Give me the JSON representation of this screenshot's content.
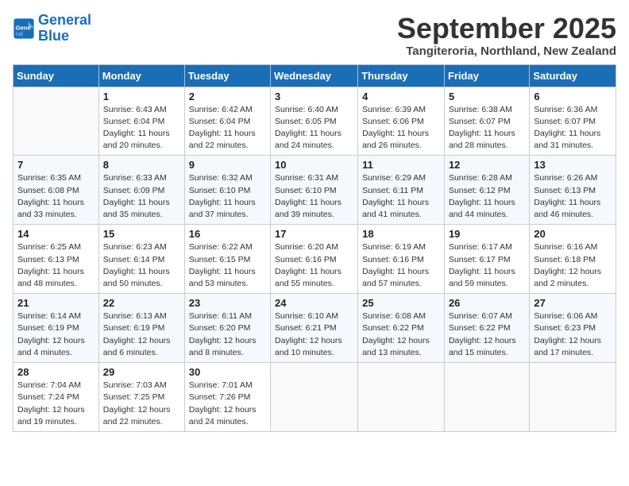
{
  "logo": {
    "line1": "General",
    "line2": "Blue"
  },
  "title": "September 2025",
  "subtitle": "Tangiteroria, Northland, New Zealand",
  "days_header": [
    "Sunday",
    "Monday",
    "Tuesday",
    "Wednesday",
    "Thursday",
    "Friday",
    "Saturday"
  ],
  "weeks": [
    [
      {
        "num": "",
        "info": ""
      },
      {
        "num": "1",
        "info": "Sunrise: 6:43 AM\nSunset: 6:04 PM\nDaylight: 11 hours\nand 20 minutes."
      },
      {
        "num": "2",
        "info": "Sunrise: 6:42 AM\nSunset: 6:04 PM\nDaylight: 11 hours\nand 22 minutes."
      },
      {
        "num": "3",
        "info": "Sunrise: 6:40 AM\nSunset: 6:05 PM\nDaylight: 11 hours\nand 24 minutes."
      },
      {
        "num": "4",
        "info": "Sunrise: 6:39 AM\nSunset: 6:06 PM\nDaylight: 11 hours\nand 26 minutes."
      },
      {
        "num": "5",
        "info": "Sunrise: 6:38 AM\nSunset: 6:07 PM\nDaylight: 11 hours\nand 28 minutes."
      },
      {
        "num": "6",
        "info": "Sunrise: 6:36 AM\nSunset: 6:07 PM\nDaylight: 11 hours\nand 31 minutes."
      }
    ],
    [
      {
        "num": "7",
        "info": "Sunrise: 6:35 AM\nSunset: 6:08 PM\nDaylight: 11 hours\nand 33 minutes."
      },
      {
        "num": "8",
        "info": "Sunrise: 6:33 AM\nSunset: 6:09 PM\nDaylight: 11 hours\nand 35 minutes."
      },
      {
        "num": "9",
        "info": "Sunrise: 6:32 AM\nSunset: 6:10 PM\nDaylight: 11 hours\nand 37 minutes."
      },
      {
        "num": "10",
        "info": "Sunrise: 6:31 AM\nSunset: 6:10 PM\nDaylight: 11 hours\nand 39 minutes."
      },
      {
        "num": "11",
        "info": "Sunrise: 6:29 AM\nSunset: 6:11 PM\nDaylight: 11 hours\nand 41 minutes."
      },
      {
        "num": "12",
        "info": "Sunrise: 6:28 AM\nSunset: 6:12 PM\nDaylight: 11 hours\nand 44 minutes."
      },
      {
        "num": "13",
        "info": "Sunrise: 6:26 AM\nSunset: 6:13 PM\nDaylight: 11 hours\nand 46 minutes."
      }
    ],
    [
      {
        "num": "14",
        "info": "Sunrise: 6:25 AM\nSunset: 6:13 PM\nDaylight: 11 hours\nand 48 minutes."
      },
      {
        "num": "15",
        "info": "Sunrise: 6:23 AM\nSunset: 6:14 PM\nDaylight: 11 hours\nand 50 minutes."
      },
      {
        "num": "16",
        "info": "Sunrise: 6:22 AM\nSunset: 6:15 PM\nDaylight: 11 hours\nand 53 minutes."
      },
      {
        "num": "17",
        "info": "Sunrise: 6:20 AM\nSunset: 6:16 PM\nDaylight: 11 hours\nand 55 minutes."
      },
      {
        "num": "18",
        "info": "Sunrise: 6:19 AM\nSunset: 6:16 PM\nDaylight: 11 hours\nand 57 minutes."
      },
      {
        "num": "19",
        "info": "Sunrise: 6:17 AM\nSunset: 6:17 PM\nDaylight: 11 hours\nand 59 minutes."
      },
      {
        "num": "20",
        "info": "Sunrise: 6:16 AM\nSunset: 6:18 PM\nDaylight: 12 hours\nand 2 minutes."
      }
    ],
    [
      {
        "num": "21",
        "info": "Sunrise: 6:14 AM\nSunset: 6:19 PM\nDaylight: 12 hours\nand 4 minutes."
      },
      {
        "num": "22",
        "info": "Sunrise: 6:13 AM\nSunset: 6:19 PM\nDaylight: 12 hours\nand 6 minutes."
      },
      {
        "num": "23",
        "info": "Sunrise: 6:11 AM\nSunset: 6:20 PM\nDaylight: 12 hours\nand 8 minutes."
      },
      {
        "num": "24",
        "info": "Sunrise: 6:10 AM\nSunset: 6:21 PM\nDaylight: 12 hours\nand 10 minutes."
      },
      {
        "num": "25",
        "info": "Sunrise: 6:08 AM\nSunset: 6:22 PM\nDaylight: 12 hours\nand 13 minutes."
      },
      {
        "num": "26",
        "info": "Sunrise: 6:07 AM\nSunset: 6:22 PM\nDaylight: 12 hours\nand 15 minutes."
      },
      {
        "num": "27",
        "info": "Sunrise: 6:06 AM\nSunset: 6:23 PM\nDaylight: 12 hours\nand 17 minutes."
      }
    ],
    [
      {
        "num": "28",
        "info": "Sunrise: 7:04 AM\nSunset: 7:24 PM\nDaylight: 12 hours\nand 19 minutes."
      },
      {
        "num": "29",
        "info": "Sunrise: 7:03 AM\nSunset: 7:25 PM\nDaylight: 12 hours\nand 22 minutes."
      },
      {
        "num": "30",
        "info": "Sunrise: 7:01 AM\nSunset: 7:26 PM\nDaylight: 12 hours\nand 24 minutes."
      },
      {
        "num": "",
        "info": ""
      },
      {
        "num": "",
        "info": ""
      },
      {
        "num": "",
        "info": ""
      },
      {
        "num": "",
        "info": ""
      }
    ]
  ]
}
